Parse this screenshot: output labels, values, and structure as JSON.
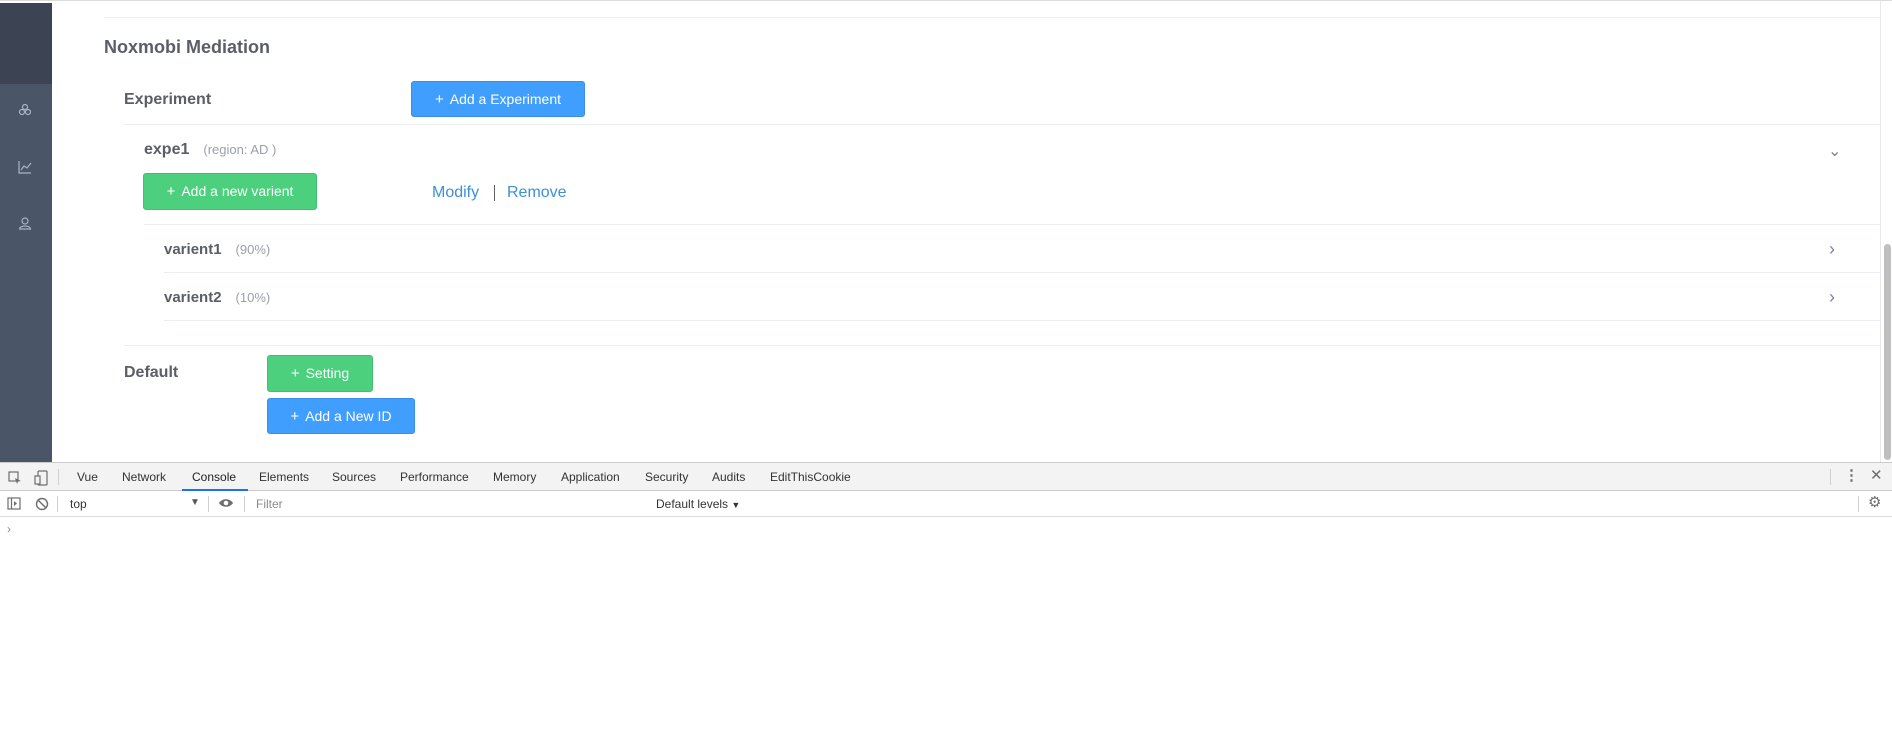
{
  "page": {
    "title": "Noxmobi Mediation"
  },
  "experiment": {
    "label": "Experiment",
    "add_button": "Add a Experiment",
    "item": {
      "name": "expe1",
      "region": "(region: AD )",
      "add_variant_button": "Add a new varient",
      "modify": "Modify",
      "remove": "Remove",
      "variants": [
        {
          "name": "varient1",
          "percent": "(90%)"
        },
        {
          "name": "varient2",
          "percent": "(10%)"
        }
      ]
    }
  },
  "default": {
    "label": "Default",
    "setting_button": "Setting",
    "add_id_button": "Add a New ID"
  },
  "icons": {
    "plus": "+",
    "chevron_down": "⌄",
    "chevron_right": "›"
  },
  "devtools": {
    "tabs": [
      "Vue",
      "Network",
      "Console",
      "Elements",
      "Sources",
      "Performance",
      "Memory",
      "Application",
      "Security",
      "Audits",
      "EditThisCookie"
    ],
    "active_tab": "Console",
    "context": "top",
    "filter_placeholder": "Filter",
    "levels": "Default levels",
    "prompt": "›"
  },
  "colors": {
    "primary": "#409eff",
    "success": "#4cd07d",
    "link": "#3e8fd6",
    "sidebar": "#4b5568"
  }
}
